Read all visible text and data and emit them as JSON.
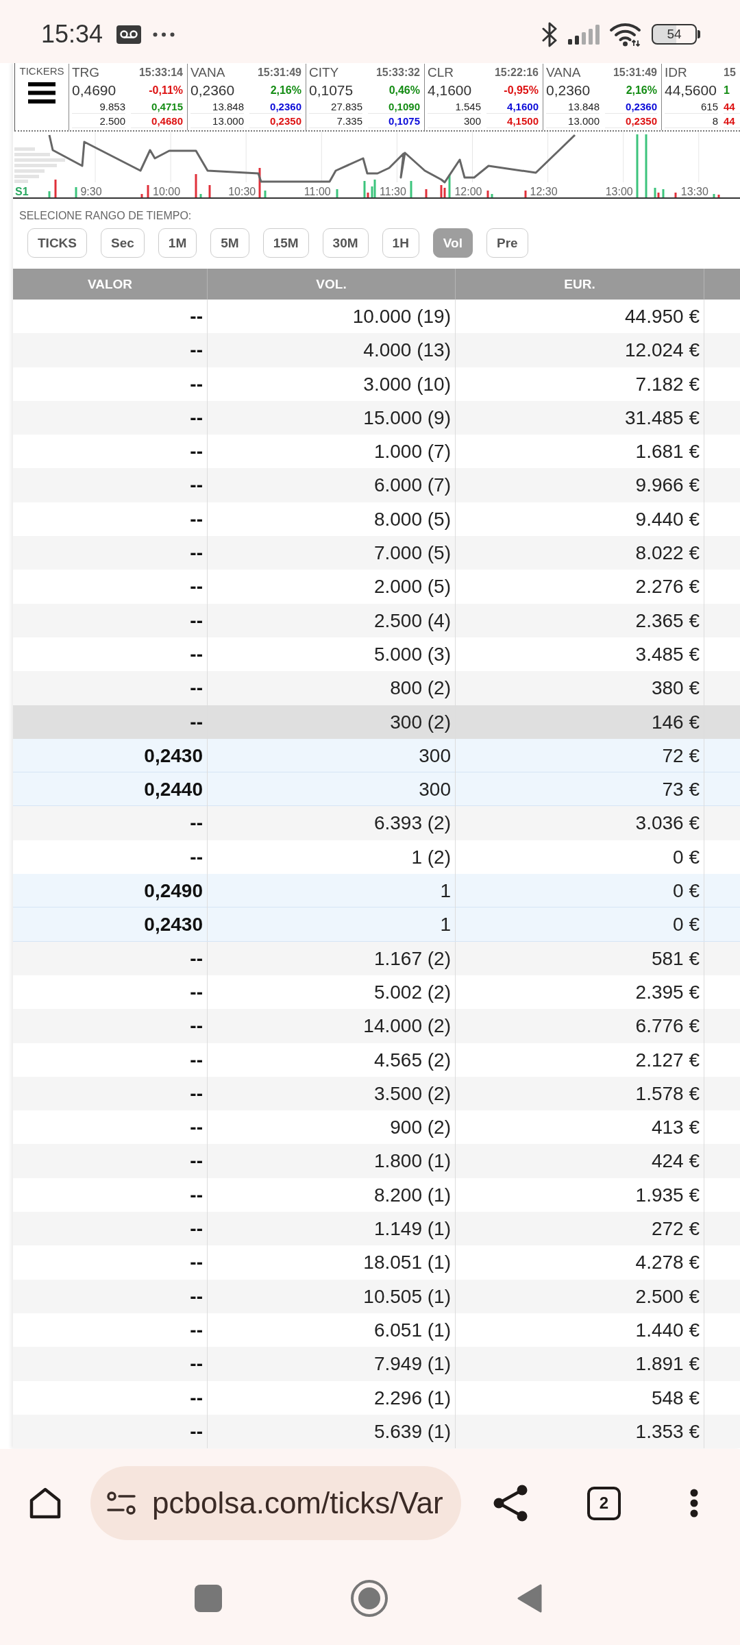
{
  "status_bar": {
    "time": "15:34",
    "battery": "54"
  },
  "tickers": {
    "label": "TICKERS",
    "items": [
      {
        "symbol": "TRG",
        "time": "15:33:14",
        "price": "0,4690",
        "change": {
          "text": "-0,11%",
          "color": "#dd1111"
        },
        "lines": [
          {
            "volume": "9.853",
            "price": "0,4715",
            "color": "#148c14"
          },
          {
            "volume": "2.500",
            "price": "0,4680",
            "color": "#dd1111"
          }
        ]
      },
      {
        "symbol": "VANA",
        "time": "15:31:49",
        "price": "0,2360",
        "change": {
          "text": "2,16%",
          "color": "#148c14"
        },
        "lines": [
          {
            "volume": "13.848",
            "price": "0,2360",
            "color": "#0a0ad8"
          },
          {
            "volume": "13.000",
            "price": "0,2350",
            "color": "#dd1111"
          }
        ]
      },
      {
        "symbol": "CITY",
        "time": "15:33:32",
        "price": "0,1075",
        "change": {
          "text": "0,46%",
          "color": "#148c14"
        },
        "lines": [
          {
            "volume": "27.835",
            "price": "0,1090",
            "color": "#148c14"
          },
          {
            "volume": "7.335",
            "price": "0,1075",
            "color": "#0a0ad8"
          }
        ]
      },
      {
        "symbol": "CLR",
        "time": "15:22:16",
        "price": "4,1600",
        "change": {
          "text": "-0,95%",
          "color": "#dd1111"
        },
        "lines": [
          {
            "volume": "1.545",
            "price": "4,1600",
            "color": "#0a0ad8"
          },
          {
            "volume": "300",
            "price": "4,1500",
            "color": "#dd1111"
          }
        ]
      },
      {
        "symbol": "VANA",
        "time": "15:31:49",
        "price": "0,2360",
        "change": {
          "text": "2,16%",
          "color": "#148c14"
        },
        "lines": [
          {
            "volume": "13.848",
            "price": "0,2360",
            "color": "#0a0ad8"
          },
          {
            "volume": "13.000",
            "price": "0,2350",
            "color": "#dd1111"
          }
        ]
      },
      {
        "symbol": "IDR",
        "time": "15",
        "price": "44,5600",
        "change": {
          "text": "1",
          "color": "#148c14"
        },
        "lines": [
          {
            "volume": "615",
            "price": "44",
            "color": "#dd1111"
          },
          {
            "volume": "8",
            "price": "44",
            "color": "#dd1111"
          }
        ]
      }
    ]
  },
  "chart": {
    "series_label": "S1",
    "time_labels": [
      "9:30",
      "10:00",
      "10:30",
      "11:00",
      "11:30",
      "12:00",
      "12:30",
      "13:00",
      "13:30"
    ]
  },
  "range_selector": {
    "label": "SELECIONE RANGO DE TIEMPO:",
    "options": [
      {
        "label": "TICKS",
        "selected": false
      },
      {
        "label": "Sec",
        "selected": false
      },
      {
        "label": "1M",
        "selected": false
      },
      {
        "label": "5M",
        "selected": false
      },
      {
        "label": "15M",
        "selected": false
      },
      {
        "label": "30M",
        "selected": false
      },
      {
        "label": "1H",
        "selected": false
      },
      {
        "label": "Vol",
        "selected": true
      },
      {
        "label": "Pre",
        "selected": false
      }
    ]
  },
  "table": {
    "columns": [
      "VALOR",
      "VOL.",
      "EUR."
    ],
    "rows": [
      {
        "cells": [
          "--",
          "10.000 (19)",
          "44.950 €"
        ],
        "selected": false
      },
      {
        "cells": [
          "--",
          "4.000 (13)",
          "12.024 €"
        ],
        "selected": false
      },
      {
        "cells": [
          "--",
          "3.000 (10)",
          "7.182 €"
        ],
        "selected": false
      },
      {
        "cells": [
          "--",
          "15.000 (9)",
          "31.485 €"
        ],
        "selected": false
      },
      {
        "cells": [
          "--",
          "1.000 (7)",
          "1.681 €"
        ],
        "selected": false
      },
      {
        "cells": [
          "--",
          "6.000 (7)",
          "9.966 €"
        ],
        "selected": false
      },
      {
        "cells": [
          "--",
          "8.000 (5)",
          "9.440 €"
        ],
        "selected": false
      },
      {
        "cells": [
          "--",
          "7.000 (5)",
          "8.022 €"
        ],
        "selected": false
      },
      {
        "cells": [
          "--",
          "2.000 (5)",
          "2.276 €"
        ],
        "selected": false
      },
      {
        "cells": [
          "--",
          "2.500 (4)",
          "2.365 €"
        ],
        "selected": false
      },
      {
        "cells": [
          "--",
          "5.000 (3)",
          "3.485 €"
        ],
        "selected": false
      },
      {
        "cells": [
          "--",
          "800 (2)",
          "380 €"
        ],
        "selected": false
      },
      {
        "cells": [
          "--",
          "300 (2)",
          "146 €"
        ],
        "selected": true,
        "children": [
          {
            "cells": [
              "0,2430",
              "300",
              "72 €"
            ],
            "selected": false
          },
          {
            "cells": [
              "0,2440",
              "300",
              "73 €"
            ],
            "selected": false
          }
        ]
      },
      {
        "cells": [
          "--",
          "6.393 (2)",
          "3.036 €"
        ],
        "selected": false
      },
      {
        "cells": [
          "--",
          "1 (2)",
          "0 €"
        ],
        "selected": false,
        "children": [
          {
            "cells": [
              "0,2490",
              "1",
              "0 €"
            ],
            "selected": false
          },
          {
            "cells": [
              "0,2430",
              "1",
              "0 €"
            ],
            "selected": false
          }
        ]
      },
      {
        "cells": [
          "--",
          "1.167 (2)",
          "581 €"
        ],
        "selected": false
      },
      {
        "cells": [
          "--",
          "5.002 (2)",
          "2.395 €"
        ],
        "selected": false
      },
      {
        "cells": [
          "--",
          "14.000 (2)",
          "6.776 €"
        ],
        "selected": false
      },
      {
        "cells": [
          "--",
          "4.565 (2)",
          "2.127 €"
        ],
        "selected": false
      },
      {
        "cells": [
          "--",
          "3.500 (2)",
          "1.578 €"
        ],
        "selected": false
      },
      {
        "cells": [
          "--",
          "900 (2)",
          "413 €"
        ],
        "selected": false
      },
      {
        "cells": [
          "--",
          "1.800 (1)",
          "424 €"
        ],
        "selected": false
      },
      {
        "cells": [
          "--",
          "8.200 (1)",
          "1.935 €"
        ],
        "selected": false
      },
      {
        "cells": [
          "--",
          "1.149 (1)",
          "272 €"
        ],
        "selected": false
      },
      {
        "cells": [
          "--",
          "18.051 (1)",
          "4.278 €"
        ],
        "selected": false
      },
      {
        "cells": [
          "--",
          "10.505 (1)",
          "2.500 €"
        ],
        "selected": false
      },
      {
        "cells": [
          "--",
          "6.051 (1)",
          "1.440 €"
        ],
        "selected": false
      },
      {
        "cells": [
          "--",
          "7.949 (1)",
          "1.891 €"
        ],
        "selected": false
      },
      {
        "cells": [
          "--",
          "2.296 (1)",
          "548 €"
        ],
        "selected": false
      },
      {
        "cells": [
          "--",
          "5.639 (1)",
          "1.353 €"
        ],
        "selected": false
      }
    ]
  },
  "browser": {
    "url": "pcbolsa.com/ticks/Var",
    "tab_count": "2"
  }
}
